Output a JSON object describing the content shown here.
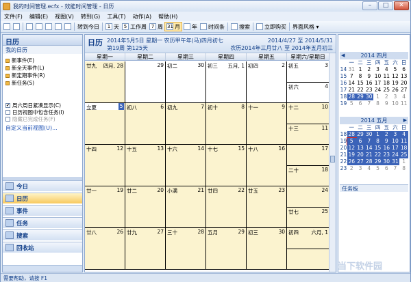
{
  "window": {
    "title": "我的时间管理.ecfx - 效能时间管理 - 日历",
    "min": "–",
    "max": "□",
    "close": "✕"
  },
  "menu": [
    "文件(F)",
    "编辑(E)",
    "视图(V)",
    "转到(G)",
    "工具(T)",
    "动作(A)",
    "帮助(H)"
  ],
  "toolbar": {
    "goto_today": "转到今日",
    "day_num": "1",
    "day": "天",
    "wd_num": "5",
    "workweek": "工作周",
    "wk_num": "7",
    "week": "周",
    "month_num": "31",
    "month": "月",
    "year": "年",
    "timeline": "时间条",
    "search": "搜索",
    "buy": "立即购买",
    "style": "界面风格"
  },
  "left": {
    "header": "日历",
    "my_calendar": "我的日历",
    "actions": [
      "新事件(E)",
      "新全天事件(L)",
      "新定期事件(R)",
      "新任务(S)"
    ],
    "checks": [
      {
        "label": "周六周日紧凑显示(C)",
        "checked": "✔"
      },
      {
        "label": "日历视图中包含任务(I)",
        "checked": ""
      },
      {
        "label": "隐藏已完成任务(F)",
        "checked": ""
      }
    ],
    "custom_view": "自定义当前视图(U)...",
    "nav": [
      "今日",
      "日历",
      "事件",
      "任务",
      "搜索",
      "回收站"
    ]
  },
  "center": {
    "title": "日历",
    "date_line": "2014年5月5日 星期一 农历甲午年(马)四月初七",
    "week_line": "第19周 第125天",
    "range_line": "2014/4/27 至 2014/5/31",
    "lunar_range": "农历2014年三月廿八 至 2014年五月初三",
    "weekdays": [
      "星期一",
      "星期二",
      "星期三",
      "星期四",
      "星期五",
      "星期六/星期日"
    ],
    "weeks": [
      [
        [
          "廿九",
          "四月, 28"
        ],
        [
          "",
          "29"
        ],
        [
          "初二",
          "30"
        ],
        [
          "初三",
          "五月, 1"
        ],
        [
          "初四",
          "2"
        ]
      ],
      [
        [
          "立夏",
          "5"
        ],
        [
          "初八",
          "6"
        ],
        [
          "初九",
          "7"
        ],
        [
          "初十",
          "8"
        ],
        [
          "十一",
          "9"
        ]
      ],
      [
        [
          "十四",
          "12"
        ],
        [
          "十五",
          "13"
        ],
        [
          "十六",
          "14"
        ],
        [
          "十七",
          "15"
        ],
        [
          "十八",
          "16"
        ]
      ],
      [
        [
          "廿一",
          "19"
        ],
        [
          "廿二",
          "20"
        ],
        [
          "小满",
          "21"
        ],
        [
          "廿四",
          "22"
        ],
        [
          "廿五",
          "23"
        ]
      ],
      [
        [
          "廿八",
          "26"
        ],
        [
          "廿九",
          "27"
        ],
        [
          "三十",
          "28"
        ],
        [
          "五月",
          "29"
        ],
        [
          "初三",
          "30"
        ]
      ]
    ],
    "weekends": [
      [
        [
          "初五",
          "3"
        ],
        [
          "初六",
          "4"
        ]
      ],
      [
        [
          "十二",
          "10"
        ],
        [
          "十三",
          "11"
        ]
      ],
      [
        [
          "",
          "17"
        ],
        [
          "二十",
          "18"
        ]
      ],
      [
        [
          "",
          "24"
        ],
        [
          "廿七",
          "25"
        ]
      ],
      [
        [
          "初四",
          "六月, 1"
        ],
        [
          "",
          ""
        ]
      ]
    ]
  },
  "right": {
    "april_title": "2014 四月",
    "may_title": "2014 五月",
    "dow": [
      "一",
      "二",
      "三",
      "四",
      "五",
      "六",
      "日"
    ],
    "april": [
      [
        "14",
        "31",
        "1",
        "2",
        "3",
        "4",
        "5",
        "6"
      ],
      [
        "15",
        "7",
        "8",
        "9",
        "10",
        "11",
        "12",
        "13"
      ],
      [
        "16",
        "14",
        "15",
        "16",
        "17",
        "18",
        "19",
        "20"
      ],
      [
        "17",
        "21",
        "22",
        "23",
        "24",
        "25",
        "26",
        "27"
      ],
      [
        "18",
        "28",
        "29",
        "30",
        "1",
        "2",
        "3",
        "4"
      ],
      [
        "19",
        "5",
        "6",
        "7",
        "8",
        "9",
        "10",
        "11"
      ]
    ],
    "may": [
      [
        "18",
        "28",
        "29",
        "30",
        "1",
        "2",
        "3",
        "4"
      ],
      [
        "19",
        "5",
        "6",
        "7",
        "8",
        "9",
        "10",
        "11"
      ],
      [
        "20",
        "12",
        "13",
        "14",
        "15",
        "16",
        "17",
        "18"
      ],
      [
        "21",
        "19",
        "20",
        "21",
        "22",
        "23",
        "24",
        "25"
      ],
      [
        "22",
        "26",
        "27",
        "28",
        "29",
        "30",
        "31",
        "1"
      ],
      [
        "23",
        "2",
        "3",
        "4",
        "5",
        "6",
        "7",
        "8"
      ]
    ],
    "task_board": "任务板"
  },
  "status": "需要帮助，请按 F1",
  "watermark": "当下软件园"
}
